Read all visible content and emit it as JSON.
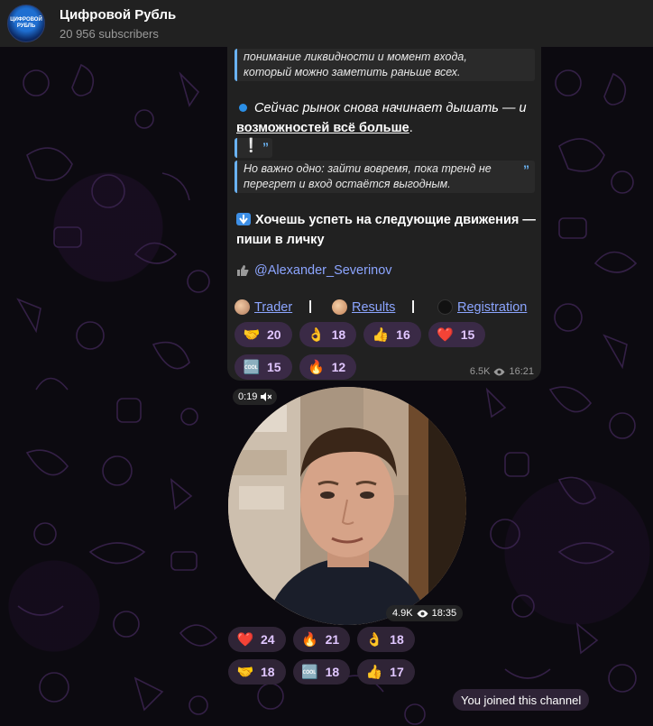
{
  "header": {
    "avatar_text": "ЦИФРОВОЙ РУБЛЬ",
    "title": "Цифровой Рубль",
    "subscribers": "20 956 subscribers"
  },
  "post": {
    "quote1_line1": "понимание ликвидности и момент входа,",
    "quote1_line2": "который можно заметить раньше всех.",
    "para1_line1": "Сейчас рынок снова начинает дышать — и",
    "para1_line2_underlined": "возможностей всё больше",
    "para1_line2_end": ".",
    "exclamation_quote": "❕",
    "quote2_line1": "Но важно одно: зайти вовремя, пока тренд не",
    "quote2_line2": "перегрет и вход остаётся выгодным.",
    "cta_line1": "Хочешь успеть на следующие движения —",
    "cta_line2": "пиши в личку",
    "mention": "@Alexander_Severinov",
    "links": {
      "trader": "Trader",
      "results": "Results",
      "registration": "Registration",
      "separator": "|"
    },
    "reactions": [
      {
        "emoji": "🤝",
        "count": "20"
      },
      {
        "emoji": "👌",
        "count": "18"
      },
      {
        "emoji": "👍",
        "count": "16"
      },
      {
        "emoji": "❤️",
        "count": "15"
      },
      {
        "emoji": "🆒",
        "count": "15"
      },
      {
        "emoji": "🔥",
        "count": "12"
      }
    ],
    "views": "6.5K",
    "time": "16:21"
  },
  "video_message": {
    "duration": "0:19",
    "muted_icon": "speaker-muted-icon",
    "views": "4.9K",
    "time": "18:35",
    "reactions": [
      {
        "emoji": "❤️",
        "count": "24"
      },
      {
        "emoji": "🔥",
        "count": "21"
      },
      {
        "emoji": "👌",
        "count": "18"
      },
      {
        "emoji": "🤝",
        "count": "18"
      },
      {
        "emoji": "🆒",
        "count": "18"
      },
      {
        "emoji": "👍",
        "count": "17"
      }
    ]
  },
  "service_message": "You joined this channel",
  "colors": {
    "header_bg": "#212121",
    "bubble_bg": "#212121",
    "accent_link": "#8ca5ff",
    "quote_border": "#6ab2f2",
    "reaction_bg": "#3a2a46"
  }
}
